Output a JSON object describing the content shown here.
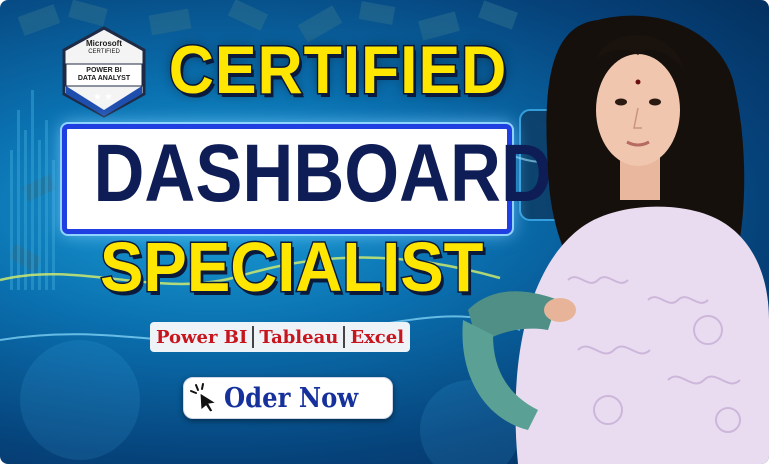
{
  "badge": {
    "brand": "Microsoft",
    "certified": "CERTIFIED",
    "line1": "POWER BI",
    "line2": "DATA ANALYST",
    "stars": "★★"
  },
  "headline": {
    "line1": "CERTIFIED",
    "line2": "DASHBOARD",
    "line3": "SPECIALIST"
  },
  "tools": {
    "items": [
      "Power BI",
      "Tableau",
      "Excel"
    ]
  },
  "cta": {
    "label": "Oder Now"
  },
  "background": {
    "screen_text": "DA"
  },
  "colors": {
    "accent_yellow": "#ffe600",
    "navy": "#0f1d56",
    "box_border": "#1f3fe0",
    "tool_red": "#c8141c",
    "cta_blue": "#16309c"
  }
}
